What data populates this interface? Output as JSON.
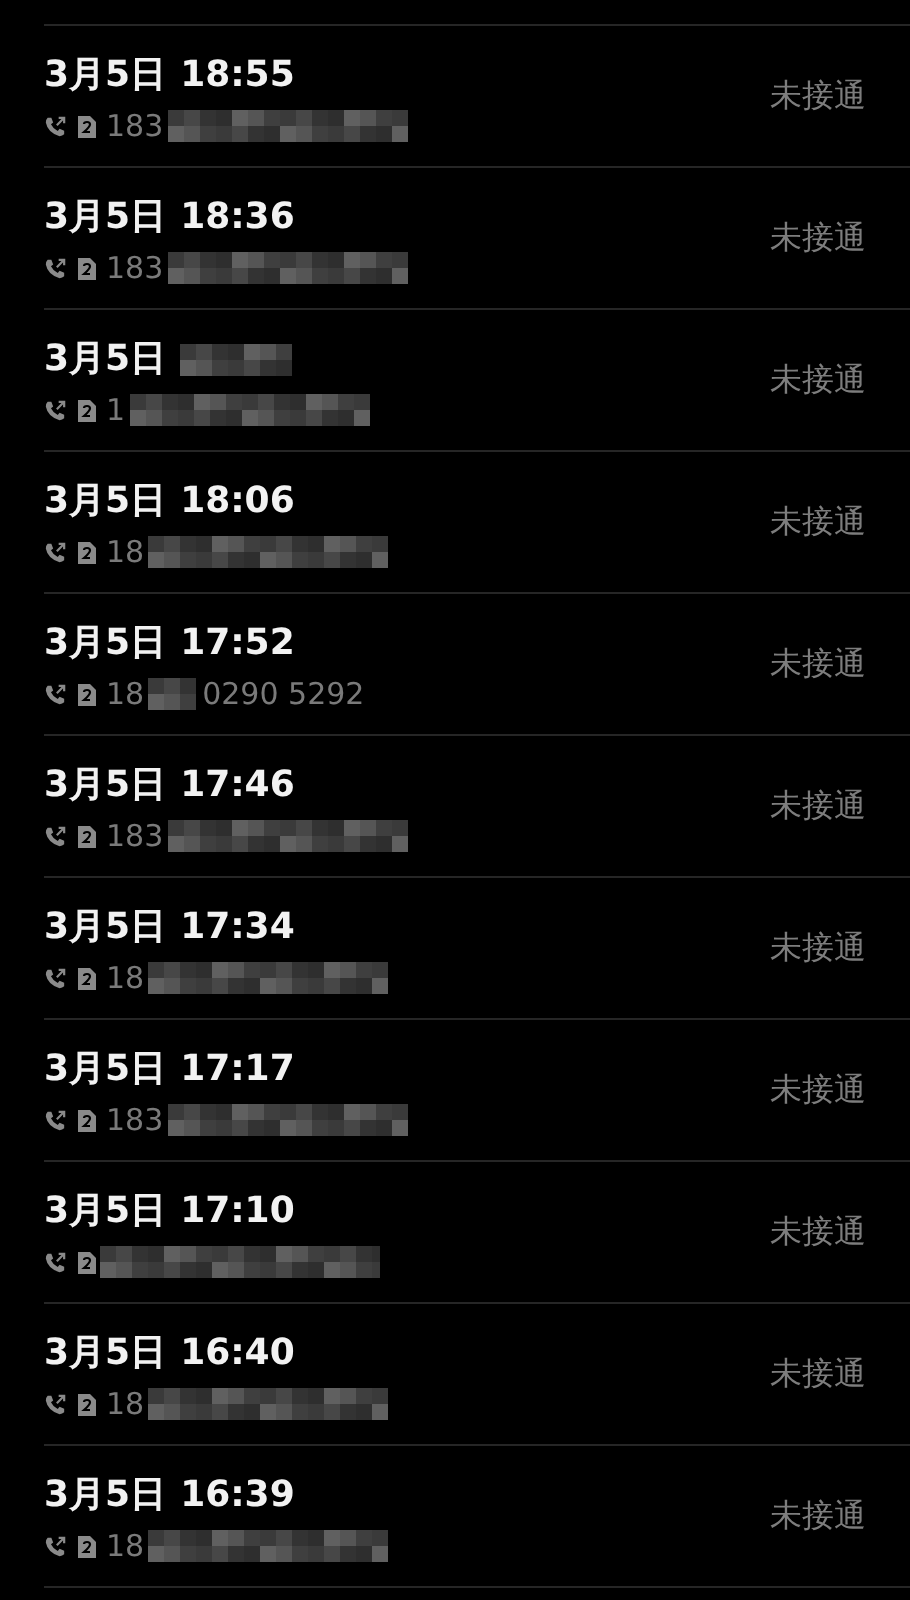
{
  "calls": [
    {
      "date": "3月5日",
      "time": "18:55",
      "number_prefix": "183",
      "status": "未接通"
    },
    {
      "date": "3月5日",
      "time": "18:36",
      "number_prefix": "183",
      "status": "未接通"
    },
    {
      "date": "3月5日",
      "number_prefix": "1",
      "status": "未接通"
    },
    {
      "date": "3月5日",
      "time": "18:06",
      "number_prefix": "18",
      "status": "未接通"
    },
    {
      "date": "3月5日",
      "time": "17:52",
      "number_prefix": "18",
      "number_suffix": "0290 5292",
      "status": "未接通"
    },
    {
      "date": "3月5日",
      "time": "17:46",
      "number_prefix": "183",
      "status": "未接通"
    },
    {
      "date": "3月5日",
      "time": "17:34",
      "number_prefix": "18",
      "status": "未接通"
    },
    {
      "date": "3月5日",
      "time": "17:17",
      "number_prefix": "183",
      "status": "未接通"
    },
    {
      "date": "3月5日",
      "time": "17:10",
      "status": "未接通"
    },
    {
      "date": "3月5日",
      "time": "16:40",
      "number_prefix": "18",
      "status": "未接通"
    },
    {
      "date": "3月5日",
      "time": "16:39",
      "number_prefix": "18",
      "status": "未接通"
    }
  ]
}
